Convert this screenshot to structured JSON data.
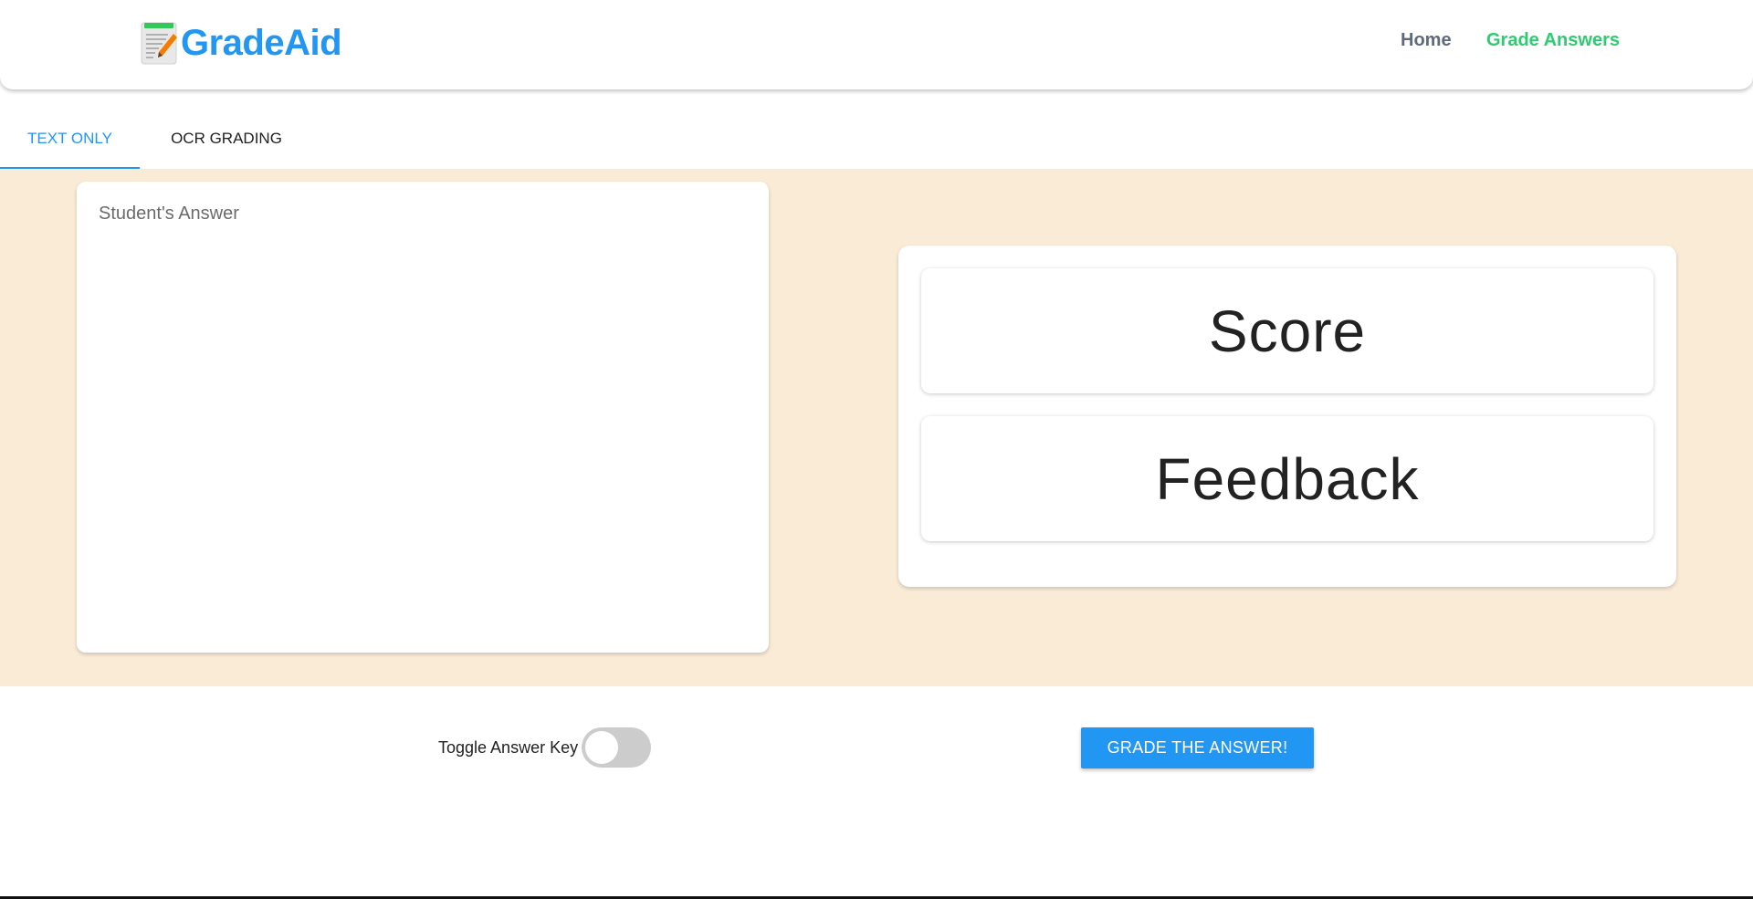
{
  "header": {
    "logo_icon": "notepad-pencil-icon",
    "app_name": "GradeAid",
    "nav": [
      {
        "label": "Home"
      },
      {
        "label": "Grade Answers"
      }
    ]
  },
  "tabs": [
    {
      "label": "TEXT ONLY",
      "active": true
    },
    {
      "label": "OCR GRADING",
      "active": false
    }
  ],
  "answer": {
    "placeholder": "Student's Answer",
    "value": ""
  },
  "results": {
    "score_label": "Score",
    "feedback_label": "Feedback"
  },
  "controls": {
    "toggle_label": "Toggle Answer Key",
    "toggle_on": false,
    "grade_button": "GRADE THE ANSWER!"
  },
  "colors": {
    "brand": "#2196f3",
    "nav_active": "#2ecc71",
    "band_background": "#faebd7"
  }
}
